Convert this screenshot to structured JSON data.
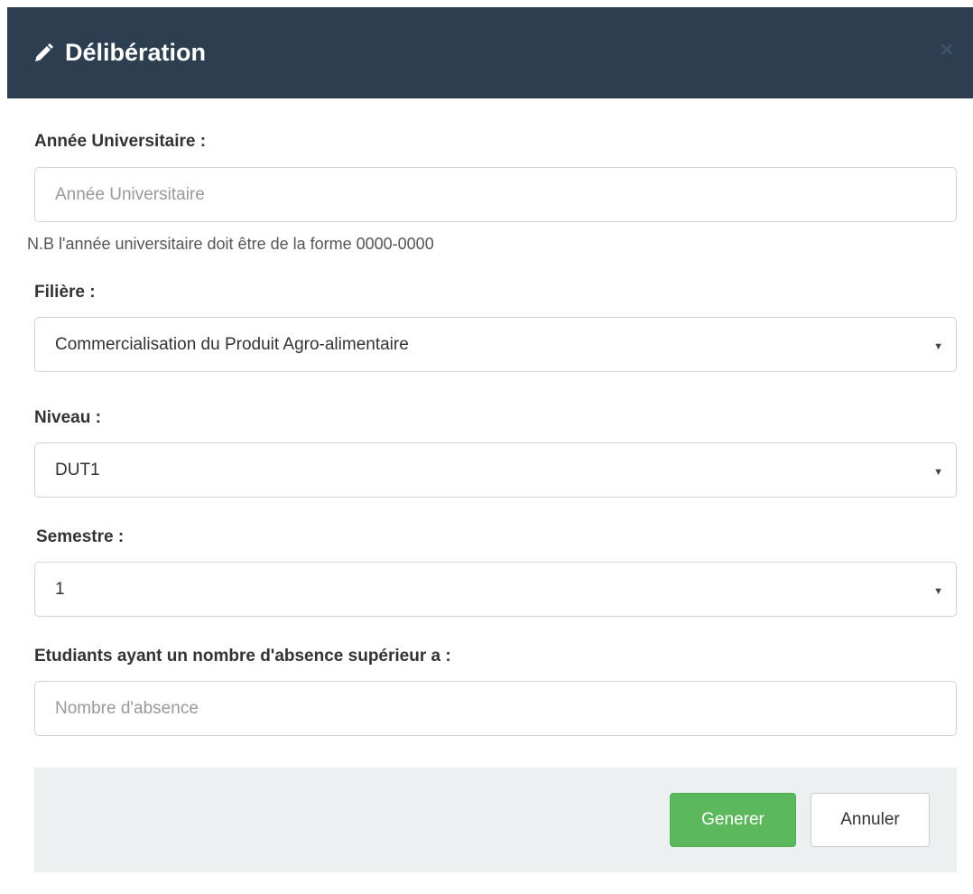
{
  "modal": {
    "title": "Délibération",
    "close_symbol": "×"
  },
  "form": {
    "annee": {
      "label": "Année Universitaire :",
      "placeholder": "Année Universitaire",
      "help": "N.B l'année universitaire doit être de la forme 0000-0000"
    },
    "filiere": {
      "label": "Filière :",
      "selected": "Commercialisation du Produit Agro-alimentaire"
    },
    "niveau": {
      "label": "Niveau :",
      "selected": "DUT1"
    },
    "semestre": {
      "label": "Semestre :",
      "selected": "1"
    },
    "absence": {
      "label": "Etudiants ayant un nombre d'absence supérieur a :",
      "placeholder": "Nombre d'absence"
    }
  },
  "footer": {
    "generate_label": "Generer",
    "cancel_label": "Annuler"
  },
  "colors": {
    "header_bg": "#2c3e50",
    "success": "#5cb85c",
    "footer_bg": "#ecf0f1"
  },
  "icons": {
    "title_icon": "pencil-icon",
    "close_icon": "close-icon",
    "select_caret": "caret-down-icon"
  }
}
